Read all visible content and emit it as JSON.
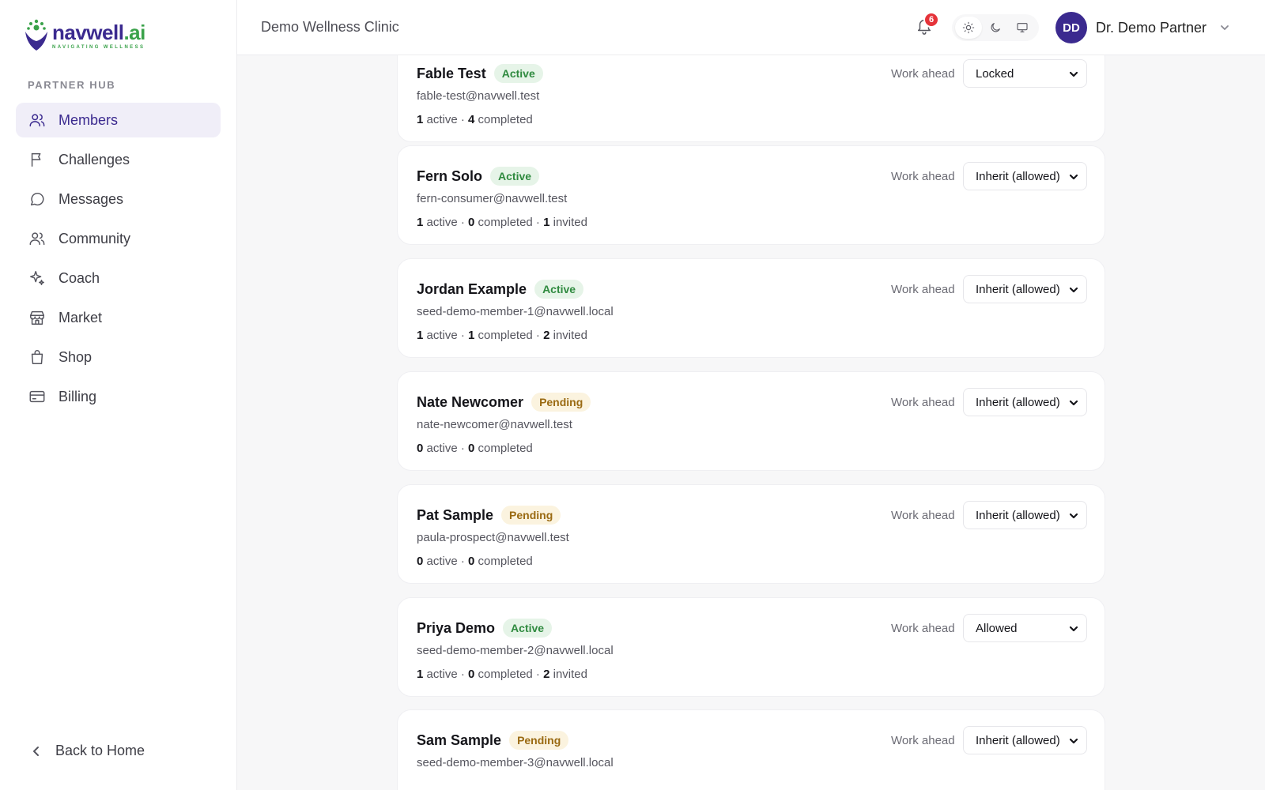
{
  "brand": {
    "name_main": "navwell",
    "name_suffix": ".ai",
    "tagline": "NAVIGATING WELLNESS",
    "primary_color": "#3b2a8f",
    "accent_color": "#3aa24a"
  },
  "sidebar": {
    "section_label": "PARTNER HUB",
    "items": [
      {
        "label": "Members",
        "icon": "users-icon",
        "active": true
      },
      {
        "label": "Challenges",
        "icon": "flag-icon"
      },
      {
        "label": "Messages",
        "icon": "message-icon"
      },
      {
        "label": "Community",
        "icon": "community-icon"
      },
      {
        "label": "Coach",
        "icon": "sparkles-icon"
      },
      {
        "label": "Market",
        "icon": "store-icon"
      },
      {
        "label": "Shop",
        "icon": "shopping-bag-icon"
      },
      {
        "label": "Billing",
        "icon": "credit-card-icon"
      }
    ],
    "back_label": "Back to Home"
  },
  "header": {
    "clinic_name": "Demo Wellness Clinic",
    "notification_count": "6",
    "user_initials": "DD",
    "user_name": "Dr. Demo Partner"
  },
  "members": [
    {
      "name": "Fable Test",
      "status": "Active",
      "email": "fable-test@navwell.test",
      "active": "1",
      "completed": "4",
      "invited": null,
      "work_ahead_label": "Work ahead",
      "work_ahead": "Locked"
    },
    {
      "name": "Fern Solo",
      "status": "Active",
      "email": "fern-consumer@navwell.test",
      "active": "1",
      "completed": "0",
      "invited": "1",
      "work_ahead_label": "Work ahead",
      "work_ahead": "Inherit (allowed)"
    },
    {
      "name": "Jordan Example",
      "status": "Active",
      "email": "seed-demo-member-1@navwell.local",
      "active": "1",
      "completed": "1",
      "invited": "2",
      "work_ahead_label": "Work ahead",
      "work_ahead": "Inherit (allowed)"
    },
    {
      "name": "Nate Newcomer",
      "status": "Pending",
      "email": "nate-newcomer@navwell.test",
      "active": "0",
      "completed": "0",
      "invited": null,
      "work_ahead_label": "Work ahead",
      "work_ahead": "Inherit (allowed)"
    },
    {
      "name": "Pat Sample",
      "status": "Pending",
      "email": "paula-prospect@navwell.test",
      "active": "0",
      "completed": "0",
      "invited": null,
      "work_ahead_label": "Work ahead",
      "work_ahead": "Inherit (allowed)"
    },
    {
      "name": "Priya Demo",
      "status": "Active",
      "email": "seed-demo-member-2@navwell.local",
      "active": "1",
      "completed": "0",
      "invited": "2",
      "work_ahead_label": "Work ahead",
      "work_ahead": "Allowed"
    },
    {
      "name": "Sam Sample",
      "status": "Pending",
      "email": "seed-demo-member-3@navwell.local",
      "active": null,
      "completed": null,
      "invited": null,
      "work_ahead_label": "Work ahead",
      "work_ahead": "Inherit (allowed)"
    }
  ],
  "stat_words": {
    "active": "active",
    "completed": "completed",
    "invited": "invited",
    "sep": " · "
  }
}
